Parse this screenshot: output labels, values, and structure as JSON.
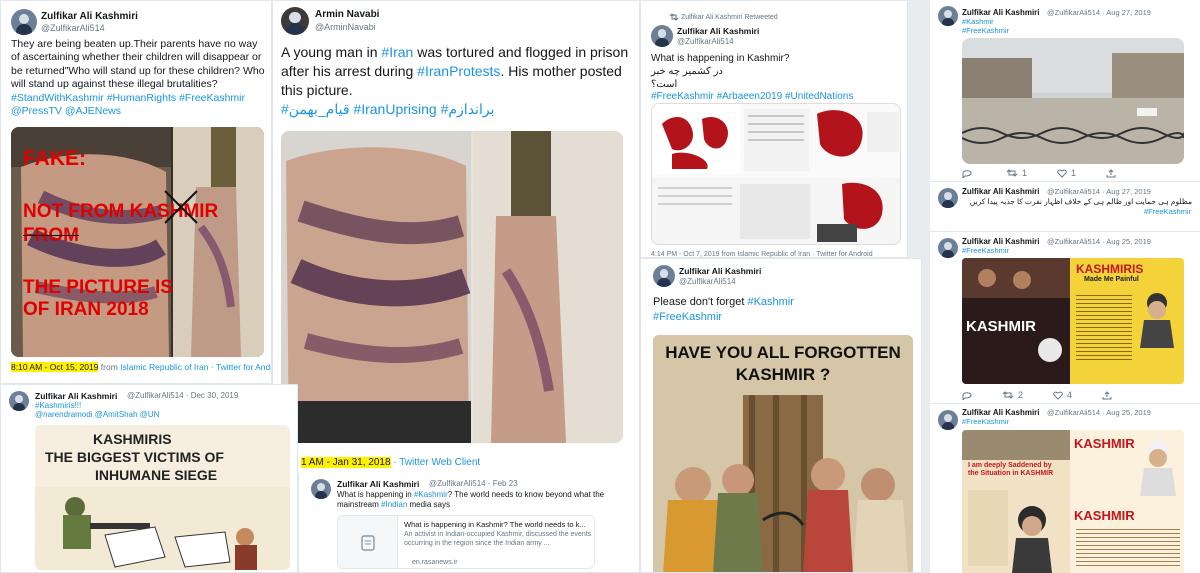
{
  "colors": {
    "link": "#1b95e0",
    "highlight": "#fff200",
    "fake_red": "#e10000",
    "muted": "#657786"
  },
  "tweet1": {
    "name": "Zulfikar Ali Kashmiri",
    "handle": "@ZulfikarAli514",
    "text_plain": "They are being beaten up.Their parents have no way of ascertaining whether their children will disappear or be returned\"Who will stand up for these children? Who will stand up against these illegal brutalities?",
    "tags": "#StandWithKashmir #HumanRights #FreeKashmir",
    "mentions": "@PressTV @AJENews",
    "overlay_fake": "FAKE:",
    "overlay_not": "NOT FROM KASHMIR",
    "overlay_from": "FROM",
    "overlay_pic": "THE PICTURE IS OF IRAN 2018",
    "time_hl": "8:10 AM - Oct 15, 2019",
    "time_rest_prefix": " from ",
    "time_place": "Islamic Republic of Iran",
    "time_client": " · Twitter for Android"
  },
  "tweet2": {
    "name": "Armin Navabi",
    "handle": "@ArminNavabi",
    "t1": "A young man in ",
    "t2": "#Iran",
    "t3": " was tortured and flogged in prison after his arrest during ",
    "t4": "#IranProtests",
    "t5": ". His mother posted this picture.",
    "tags_rtl": "#قیام_بهمن #IranUprising #براندازم",
    "time_hl": "1 AM - Jan 31, 2018",
    "time_client": " · Twitter Web Client"
  },
  "tweet3": {
    "retweet_label": "Zulfikar Ali Kashmiri Retweeted",
    "name": "Zulfikar Ali Kashmiri",
    "handle": "@ZulfikarAli514",
    "line1": "What is happening in Kashmir?",
    "line_rtl": "در کشمیر چه خبر است؟",
    "tags": "#FreeKashmir #Arbaeen2019 #UnitedNations",
    "time": "4:14 PM - Oct 7, 2019 from Islamic Republic of Iran · Twitter for Android"
  },
  "tweet4": {
    "name": "Zulfikar Ali Kashmiri",
    "handle": "@ZulfikarAli514",
    "line1": "Please don't forget ",
    "tag1": "#Kashmir",
    "tag2": "#FreeKashmir",
    "poster_line1": "HAVE YOU ALL FORGOTTEN",
    "poster_line2": "KASHMIR ?"
  },
  "tweet5": {
    "name": "Zulfikar Ali Kashmiri",
    "handle": "@ZulfikarAli514 · Dec 30, 2019",
    "tags": "#Kashmiris!!!",
    "mentions": "@narendramodi @AmitShah @UN",
    "cartoon_line1": "KASHMIRIS",
    "cartoon_line2": "THE BIGGEST VICTIMS OF",
    "cartoon_line3": "INHUMANE SIEGE"
  },
  "tweet6": {
    "name": "Zulfikar Ali Kashmiri",
    "handle": "@ZulfikarAli514 · Feb 23",
    "t1": "What is happening in ",
    "t2": "#Kashmir",
    "t3": "? The world needs to know beyond what the mainstream ",
    "t4": "#Indian",
    "t5": " media says",
    "card_title": "What is happening in Kashmir? The world needs to k...",
    "card_desc": "An activist in Indian-occupied Kashmir, discussed the events occurring in the region since the Indian army ...",
    "card_domain": "en.rasanews.ir"
  },
  "right_col": {
    "a": {
      "name": "Zulfikar Ali Kashmiri",
      "handle": "@ZulfikarAli514 · Aug 27, 2019",
      "tag1": "#Kashmir",
      "tag2": "#FreeKashmir",
      "reply": "",
      "rt": "1",
      "like": "1"
    },
    "b": {
      "name": "Zulfikar Ali Kashmiri",
      "handle": "@ZulfikarAli514 · Aug 27, 2019",
      "text_rtl": "مظلوم ہی حمایت اور ظالم ہی کے خلاف اظہار نفرت کا جذبہ پیدا کریں",
      "tag": "#FreeKashmir"
    },
    "c": {
      "name": "Zulfikar Ali Kashmiri",
      "handle": "@ZulfikarAli514 · Aug 25, 2019",
      "tag": "#FreeKashmir",
      "poster_title": "KASHMIRIS",
      "poster_sub": "Made Me Painful",
      "poster_left": "KASHMIR",
      "rt": "2",
      "like": "4"
    },
    "d": {
      "name": "Zulfikar Ali Kashmiri",
      "handle": "@ZulfikarAli514 · Aug 25, 2019",
      "tag": "#FreeKashmir",
      "poster_title": "KASHMIR",
      "poster_title2": "KASHMIR",
      "poster_left": "I am deeply Saddened by the Situation in KASHMIR"
    }
  }
}
